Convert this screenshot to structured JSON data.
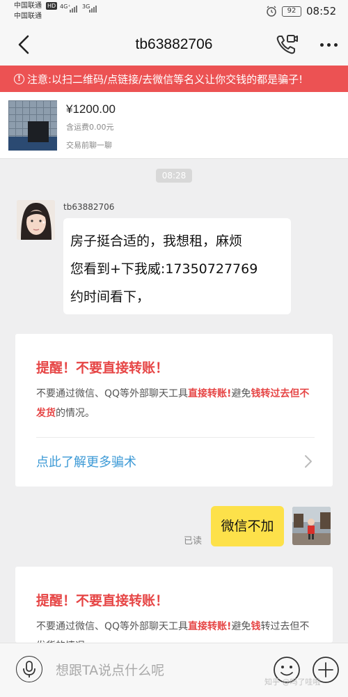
{
  "status_bar": {
    "carrier_1": "中国联通",
    "carrier_2": "中国联通",
    "hd": "HD",
    "net_1": "4G⁺",
    "net_2": "3G",
    "battery": "92",
    "time": "08:52"
  },
  "header": {
    "title": "tb63882706",
    "back_icon": "chevron-left-icon",
    "call_icon": "phone-video-icon",
    "more_icon": "more-dots-icon"
  },
  "banner": {
    "icon": "!",
    "text": "注意:以扫二维码/点链接/去微信等名义让你交钱的都是骗子!",
    "color": "#ec5253"
  },
  "item": {
    "price": "¥1200.00",
    "shipping": "含运费0.00元",
    "chat_first": "交易前聊一聊"
  },
  "chat": {
    "timestamp": "08:28",
    "incoming": {
      "sender": "tb63882706",
      "lines": [
        "房子挺合适的，我想租，麻烦",
        "您看到+下我威:17350727769",
        "约时间看下，"
      ]
    },
    "notice_1": {
      "title": "提醒！不要直接转账！",
      "text_a": "不要通过微信、QQ等外部聊天工具",
      "text_b": "直接转账!",
      "text_c": "避免",
      "text_d": "钱转过去但不发货",
      "text_e": "的情况。",
      "link": "点此了解更多骗术"
    },
    "outgoing": {
      "read": "已读",
      "text": "微信不加"
    },
    "notice_2": {
      "title": "提醒！不要直接转账！",
      "text_a": "不要通过微信、QQ等外部聊天工具",
      "text_b": "直接转账!",
      "text_c": "避免",
      "text_d": "钱",
      "text_e": "转过去但不发货的情况。"
    }
  },
  "input_bar": {
    "placeholder": "想跟TA说点什么呢",
    "mic_icon": "microphone-icon",
    "emoji_icon": "emoji-icon",
    "plus_icon": "plus-icon"
  },
  "watermark": "知乎 @吗了哇啦"
}
